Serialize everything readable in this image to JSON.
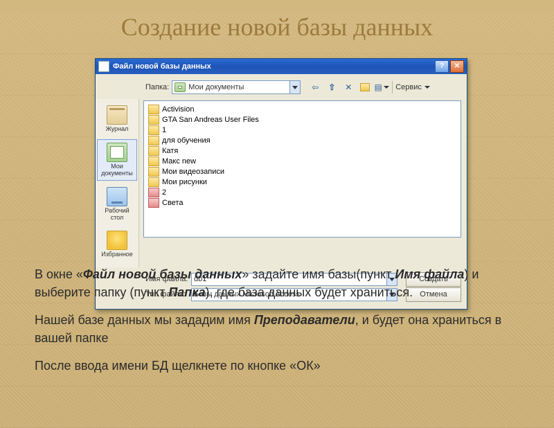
{
  "slide": {
    "title": "Создание новой базы данных"
  },
  "dialog": {
    "title": "Файл новой базы данных",
    "topbar": {
      "folder_label": "Папка:",
      "folder_value": "Мои документы",
      "service_label": "Сервис"
    },
    "places": [
      {
        "label": "Журнал"
      },
      {
        "label": "Мои документы"
      },
      {
        "label": "Рабочий стол"
      },
      {
        "label": "Избранное"
      }
    ],
    "files": [
      {
        "name": "Activision",
        "kind": "folder"
      },
      {
        "name": "GTA San Andreas User Files",
        "kind": "folder"
      },
      {
        "name": "1",
        "kind": "folder"
      },
      {
        "name": "для обучения",
        "kind": "folder"
      },
      {
        "name": "Катя",
        "kind": "folder"
      },
      {
        "name": "Макс new",
        "kind": "folder"
      },
      {
        "name": "Мои видеозаписи",
        "kind": "folder"
      },
      {
        "name": "Мои рисунки",
        "kind": "folder"
      },
      {
        "name": "2",
        "kind": "db"
      },
      {
        "name": "Света",
        "kind": "db"
      }
    ],
    "filename_label": "Имя файла:",
    "filename_value": "db1",
    "filetype_label": "Тип файла:",
    "filetype_value": "Базы данных Microsoft Access",
    "create_btn": "Создать",
    "cancel_btn": "Отмена"
  },
  "text": {
    "p1_a": "В окне «",
    "p1_b": "Файл новой базы данных",
    "p1_c": "» задайте имя базы(пункт ",
    "p1_d": "Имя файла",
    "p1_e": ") и выберите папку (пункт ",
    "p1_f": "Папка",
    "p1_g": "), где база данных будет храниться.",
    "p2_a": "Нашей базе данных мы зададим имя ",
    "p2_b": "Преподаватели",
    "p2_c": ", и будет она храниться в вашей папке",
    "p3": "После ввода имени БД щелкнете по кнопке «ОК»"
  }
}
